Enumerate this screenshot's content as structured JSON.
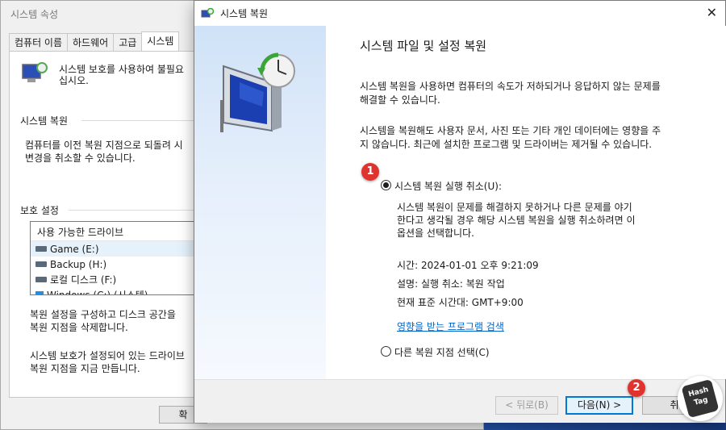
{
  "bg_dialog": {
    "title": "시스템 속성",
    "tabs": [
      "컴퓨터 이름",
      "하드웨어",
      "고급",
      "시스템 "
    ],
    "protect_text_1": "시스템 보호를 사용하여 불필요",
    "protect_text_2": "십시오.",
    "restore_group": "시스템 복원",
    "restore_text_1": "컴퓨터를 이전 복원 지점으로 되돌려 시",
    "restore_text_2": "변경을 취소할 수 있습니다.",
    "protection_group": "보호 설정",
    "drive_header": "사용 가능한 드라이브",
    "drives": [
      "Game (E:)",
      "Backup (H:)",
      "로컬 디스크 (F:)",
      "Windows (C:) (시스템)"
    ],
    "configure_text_1": "복원 설정을 구성하고 디스크 공간을 ",
    "configure_text_2": "복원 지점을 삭제합니다.",
    "create_text_1": "시스템 보호가 설정되어 있는 드라이브",
    "create_text_2": "복원 지점을 지금 만듭니다.",
    "ok_label": "확"
  },
  "dialog": {
    "title": "시스템 복원",
    "heading": "시스템 파일 및 설정 복원",
    "para1_line1": "시스템 복원을 사용하면 컴퓨터의 속도가 저하되거나 응답하지 않는 문제를",
    "para1_line2": "해결할 수 있습니다.",
    "para2_line1": "시스템을 복원해도 사용자 문서, 사진 또는 기타 개인 데이터에는 영향을 주",
    "para2_line2": "지 않습니다. 최근에 설치한 프로그램 및 드라이버는 제거될 수 있습니다.",
    "option_undo": "시스템 복원 실행 취소(U):",
    "undo_desc_1": "시스템 복원이 문제를 해결하지 못하거나 다른 문제를 야기",
    "undo_desc_2": "한다고 생각될 경우 해당 시스템 복원을 실행 취소하려면 이",
    "undo_desc_3": "옵션을 선택합니다.",
    "time": "시간: 2024-01-01 오후 9:21:09",
    "description": "설명: 실행 취소: 복원 작업",
    "timezone": "현재 표준 시간대: GMT+9:00",
    "scan_link": "영향을 받는 프로그램 검색",
    "option_choose": "다른 복원 지점 선택(C)",
    "back_label": "< 뒤로(B)",
    "next_label": "다음(N) >",
    "cancel_label": "취"
  },
  "badges": {
    "one": "1",
    "two": "2"
  },
  "logo": {
    "line1": "Hash",
    "line2": "Tag"
  },
  "colors": {
    "accent": "#0078d7",
    "link": "#0066cc",
    "badge": "#e0332e"
  }
}
